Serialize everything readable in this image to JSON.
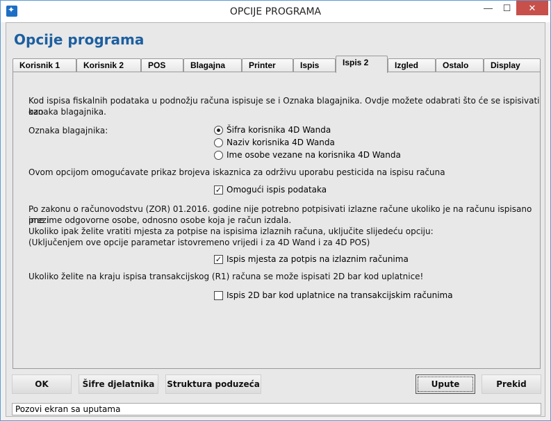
{
  "window": {
    "title": "OPCIJE PROGRAMA",
    "min": "—",
    "max": "☐",
    "close": "✕"
  },
  "page_title": "Opcije programa",
  "tabs": [
    {
      "label": "Korisnik 1"
    },
    {
      "label": "Korisnik 2"
    },
    {
      "label": "POS"
    },
    {
      "label": "Blagajna"
    },
    {
      "label": "Printer"
    },
    {
      "label": "Ispis"
    },
    {
      "label": "Ispis 2",
      "active": true
    },
    {
      "label": "Izgled"
    },
    {
      "label": "Ostalo"
    },
    {
      "label": "Display"
    }
  ],
  "panel": {
    "intro_line1": "Kod ispisa fiskalnih podataka u podnožju računa ispisuje se i Oznaka blagajnika. Ovdje možete odabrati što će se ispisivati kao",
    "intro_line2": "oznaka blagajnika.",
    "cashier_label": "Oznaka blagajnika:",
    "cashier_options": [
      {
        "label": "Šifra korisnika 4D Wanda",
        "checked": true
      },
      {
        "label": "Naziv korisnika 4D Wanda",
        "checked": false
      },
      {
        "label": "Ime osobe vezane na korisnika 4D Wanda",
        "checked": false
      }
    ],
    "pesticide_text": "Ovom opcijom omogućavate prikaz brojeva iskaznica za održivu uporabu pesticida na ispisu računa",
    "pesticide_checkbox": {
      "label": "Omogući ispis podataka",
      "checked": true
    },
    "law_lines": [
      "Po zakonu o računovodstvu (ZOR) 01.2016. godine nije potrebno potpisivati izlazne račune ukoliko je na računu ispisano ime i",
      "prezime odgovorne osobe, odnosno osobe koja je račun izdala.",
      "Ukoliko ipak želite vratiti mjesta za potpise na ispisima izlaznih računa, uključite slijedeću opciju:",
      "(Uključenjem ove opcije parametar istovremeno vrijedi i za 4D Wand i za 4D POS)"
    ],
    "signature_checkbox": {
      "label": "Ispis mjesta za potpis na izlaznim računima",
      "checked": true
    },
    "barcode_text": "Ukoliko želite na kraju ispisa transakcijskog (R1) računa se može ispisati 2D bar kod uplatnice!",
    "barcode_checkbox": {
      "label": "Ispis 2D bar kod uplatnice na transakcijskim računima",
      "checked": false
    }
  },
  "buttons": {
    "ok": "OK",
    "activity_codes": "Šifre djelatnika",
    "company_structure": "Struktura poduzeća",
    "help": "Upute",
    "cancel": "Prekid"
  },
  "status_text": "Pozovi ekran sa uputama",
  "colors": {
    "title_blue": "#1d5fa0",
    "close_red": "#c7504b"
  }
}
